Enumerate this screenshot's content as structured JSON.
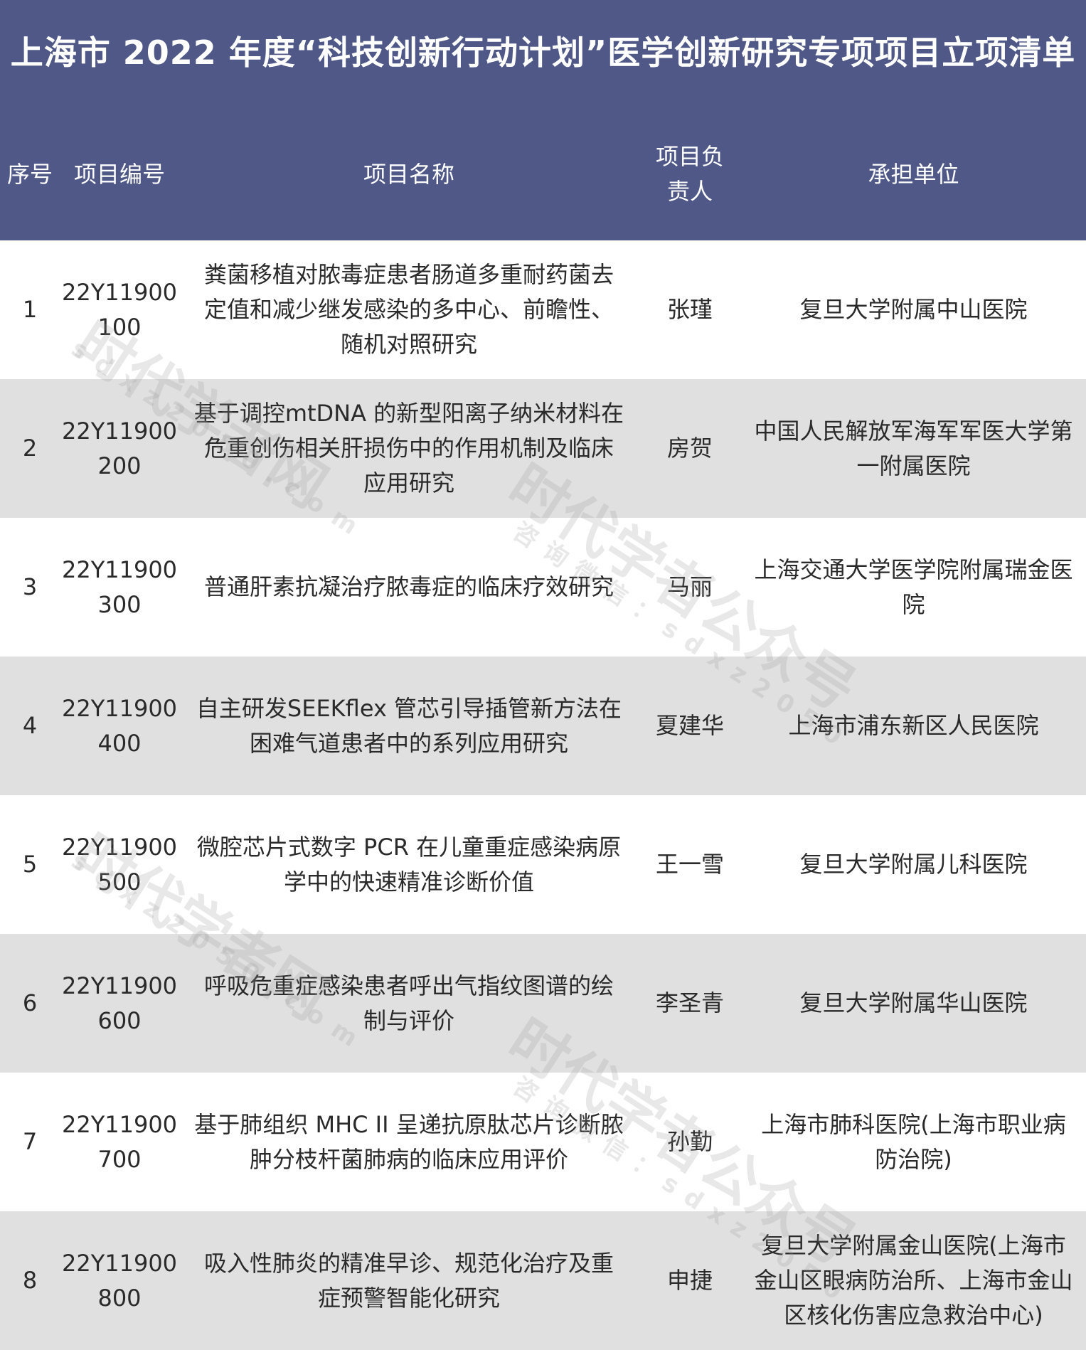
{
  "title": "上海市 2022 年度“科技创新行动计划”医学创新研究专项项目立项清单",
  "columns": {
    "index": "序号",
    "code": "项目编号",
    "name": "项目名称",
    "leader": "项目负\n责人",
    "unit": "承担单位"
  },
  "rows": [
    {
      "index": "1",
      "code": "22Y11900\n100",
      "name": "粪菌移植对脓毒症患者肠道多重耐药菌去\n定值和减少继发感染的多中心、前瞻性、\n随机对照研究",
      "leader": "张瑾",
      "unit": "复旦大学附属中山医院"
    },
    {
      "index": "2",
      "code": "22Y11900\n200",
      "name": "基于调控mtDNA 的新型阳离子纳米材料在\n危重创伤相关肝损伤中的作用机制及临床\n应用研究",
      "leader": "房贺",
      "unit": "中国人民解放军海军军医大学第\n一附属医院"
    },
    {
      "index": "3",
      "code": "22Y11900\n300",
      "name": "普通肝素抗凝治疗脓毒症的临床疗效研究",
      "leader": "马丽",
      "unit": "上海交通大学医学院附属瑞金医\n院"
    },
    {
      "index": "4",
      "code": "22Y11900\n400",
      "name": "自主研发SEEKflex 管芯引导插管新方法在\n困难气道患者中的系列应用研究",
      "leader": "夏建华",
      "unit": "上海市浦东新区人民医院"
    },
    {
      "index": "5",
      "code": "22Y11900\n500",
      "name": "微腔芯片式数字 PCR 在儿童重症感染病原\n学中的快速精准诊断价值",
      "leader": "王一雪",
      "unit": "复旦大学附属儿科医院"
    },
    {
      "index": "6",
      "code": "22Y11900\n600",
      "name": "呼吸危重症感染患者呼出气指纹图谱的绘\n制与评价",
      "leader": "李圣青",
      "unit": "复旦大学附属华山医院"
    },
    {
      "index": "7",
      "code": "22Y11900\n700",
      "name": "基于肺组织 MHC II 呈递抗原肽芯片诊断脓\n肿分枝杆菌肺病的临床应用评价",
      "leader": "孙勤",
      "unit": "上海市肺科医院(上海市职业病\n防治院)"
    },
    {
      "index": "8",
      "code": "22Y11900\n800",
      "name": "吸入性肺炎的精准早诊、规范化治疗及重\n症预警智能化研究",
      "leader": "申捷",
      "unit": "复旦大学附属金山医院(上海市\n金山区眼病防治所、上海市金山\n区核化伤害应急救治中心)"
    }
  ],
  "watermarks": {
    "w1_big": "时代学者网",
    "w1_small": "sdxz2050.com",
    "w2_big": "时代学者公众号",
    "w2_small": "咨询微信：sdxz2050",
    "w3_big": "时代学者网",
    "w3_small": "sdxz2050.com",
    "w4_big": "时代学者公众号",
    "w4_small": "咨询微信：sdxz2050"
  }
}
